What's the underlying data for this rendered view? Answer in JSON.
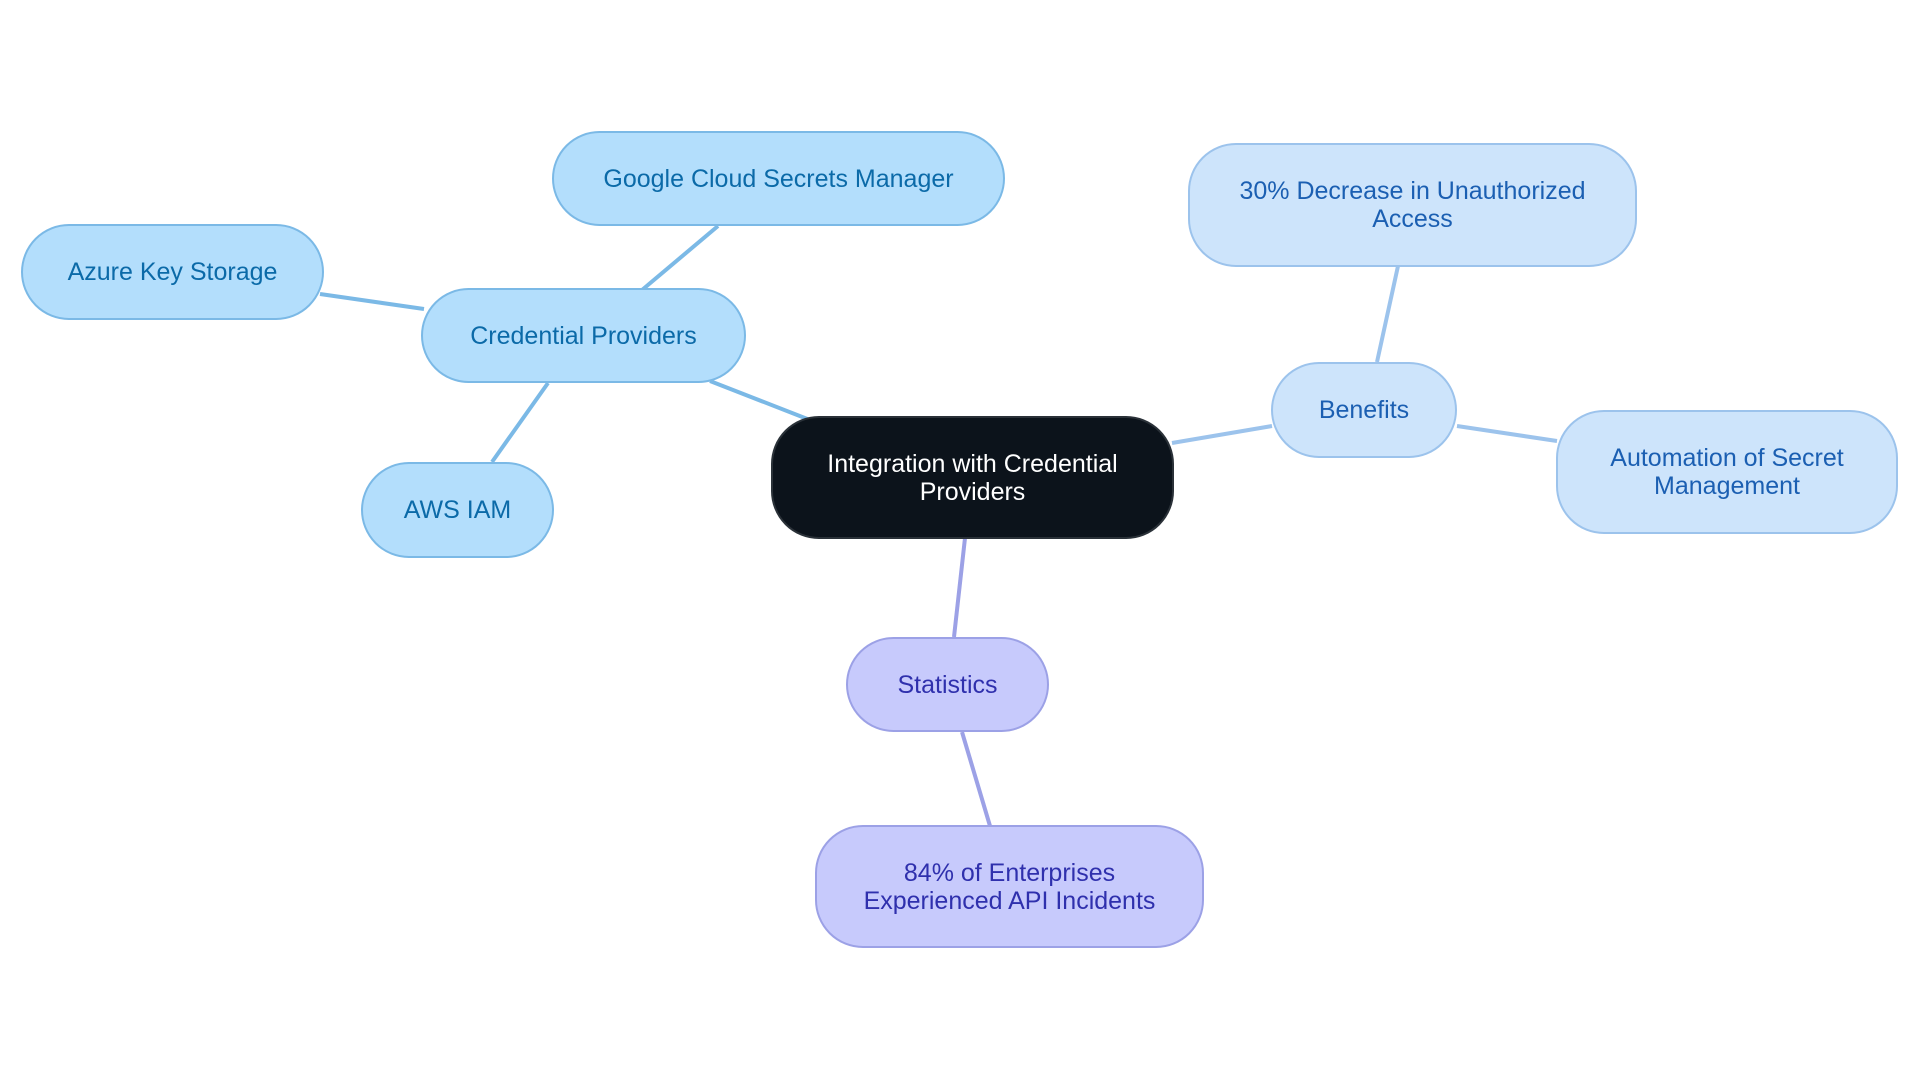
{
  "diagram": {
    "type": "mind-map",
    "colors": {
      "center_fill": "#0c131b",
      "center_text": "#ffffff",
      "providers_fill": "#b3defc",
      "providers_text": "#0b6aa8",
      "providers_edge": "#7bb9e6",
      "benefits_fill": "#cde4fb",
      "benefits_text": "#1b5fb2",
      "benefits_edge": "#9cc3ec",
      "statistics_fill": "#c7cafc",
      "statistics_text": "#2f30ad",
      "statistics_edge": "#9ca1e6"
    },
    "center": {
      "label": "Integration with Credential Providers"
    },
    "branches": [
      {
        "label": "Credential Providers",
        "children": [
          {
            "label": "Google Cloud Secrets Manager"
          },
          {
            "label": "Azure Key Storage"
          },
          {
            "label": "AWS IAM"
          }
        ]
      },
      {
        "label": "Benefits",
        "children": [
          {
            "label": "30% Decrease in Unauthorized Access"
          },
          {
            "label": "Automation of Secret Management"
          }
        ]
      },
      {
        "label": "Statistics",
        "children": [
          {
            "label": "84% of Enterprises Experienced API Incidents"
          }
        ]
      }
    ]
  }
}
